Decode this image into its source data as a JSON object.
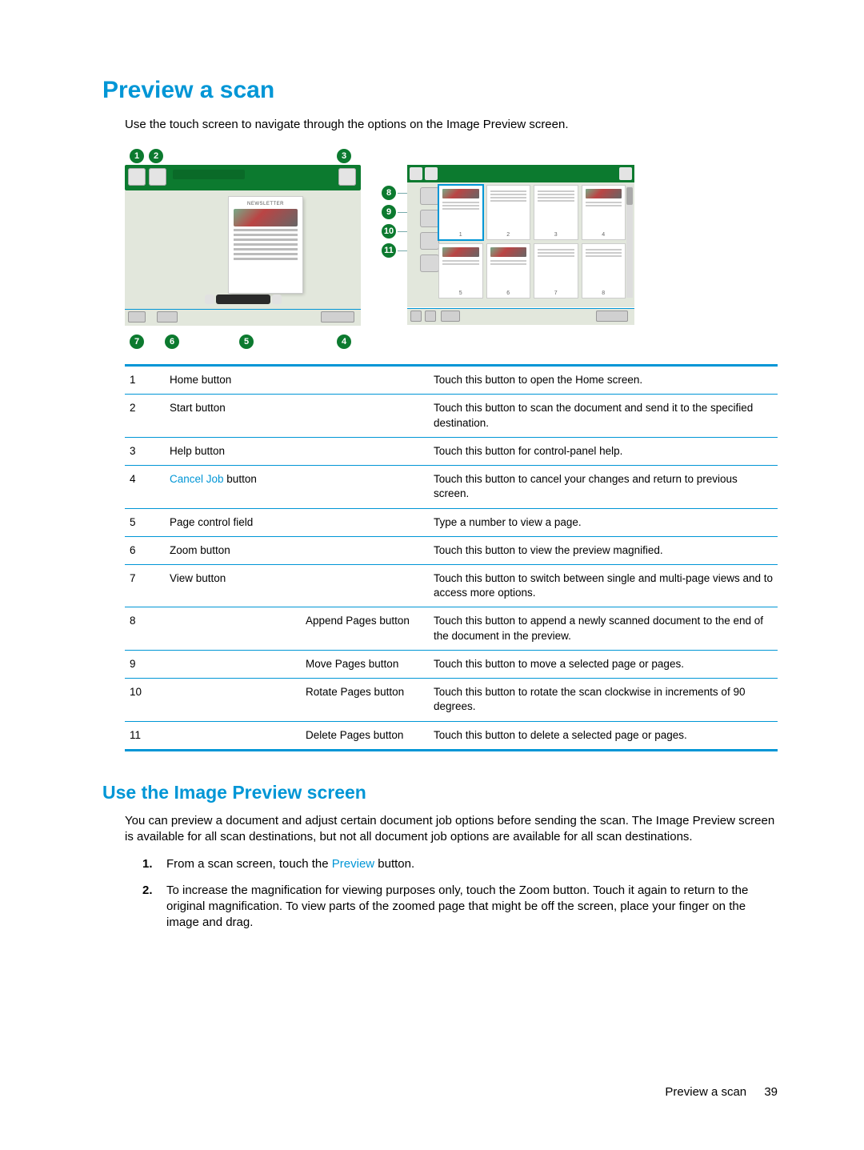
{
  "title": "Preview a scan",
  "intro": "Use the touch screen to navigate through the options on the Image Preview screen.",
  "callouts": [
    "1",
    "2",
    "3",
    "4",
    "5",
    "6",
    "7",
    "8",
    "9",
    "10",
    "11"
  ],
  "doc_heading": "NEWSLETTER",
  "thumb_page_numbers": [
    "1",
    "2",
    "3",
    "4",
    "5",
    "6",
    "7",
    "8"
  ],
  "table": [
    {
      "num": "1",
      "colA": {
        "text": "Home button"
      },
      "colB": "",
      "desc": "Touch this button to open the Home screen."
    },
    {
      "num": "2",
      "colA": {
        "text": "Start button"
      },
      "colB": "",
      "desc": "Touch this button to scan the document and send it to the specified destination."
    },
    {
      "num": "3",
      "colA": {
        "text": "Help button"
      },
      "colB": "",
      "desc": "Touch this button for control-panel help."
    },
    {
      "num": "4",
      "colA": {
        "ui": "Cancel Job",
        "suffix": " button"
      },
      "colB": "",
      "desc": "Touch this button to cancel your changes and return to previous screen."
    },
    {
      "num": "5",
      "colA": {
        "text": "Page control field"
      },
      "colB": "",
      "desc": "Type a number to view a page."
    },
    {
      "num": "6",
      "colA": {
        "text": "Zoom button"
      },
      "colB": "",
      "desc": "Touch this button to view the preview magnified."
    },
    {
      "num": "7",
      "colA": {
        "text": "View button"
      },
      "colB": "",
      "desc": "Touch this button to switch between single and multi-page views and to access more options."
    },
    {
      "num": "8",
      "colA": {
        "text": ""
      },
      "colB": "Append Pages button",
      "desc": "Touch this button to append a newly scanned document to the end of the document in the preview."
    },
    {
      "num": "9",
      "colA": {
        "text": ""
      },
      "colB": "Move Pages button",
      "desc": "Touch this button to move a selected page or pages."
    },
    {
      "num": "10",
      "colA": {
        "text": ""
      },
      "colB": "Rotate Pages button",
      "desc": "Touch this button to rotate the scan clockwise in increments of 90 degrees."
    },
    {
      "num": "11",
      "colA": {
        "text": ""
      },
      "colB": "Delete Pages button",
      "desc": "Touch this button to delete a selected page or pages."
    }
  ],
  "use_title": "Use the Image Preview screen",
  "use_para": "You can preview a document and adjust certain document job options before sending the scan. The Image Preview screen is available for all scan destinations, but not all document job options are available for all scan destinations.",
  "steps": [
    {
      "pre": "From a scan screen, touch the ",
      "ui": "Preview",
      "post": " button."
    },
    {
      "pre": "To increase the magnification for viewing purposes only, touch the Zoom button. Touch it again to return to the original magnification. To view parts of the zoomed page that might be off the screen, place your finger on the image and drag.",
      "ui": "",
      "post": ""
    }
  ],
  "footer_text": "Preview a scan",
  "footer_page": "39"
}
